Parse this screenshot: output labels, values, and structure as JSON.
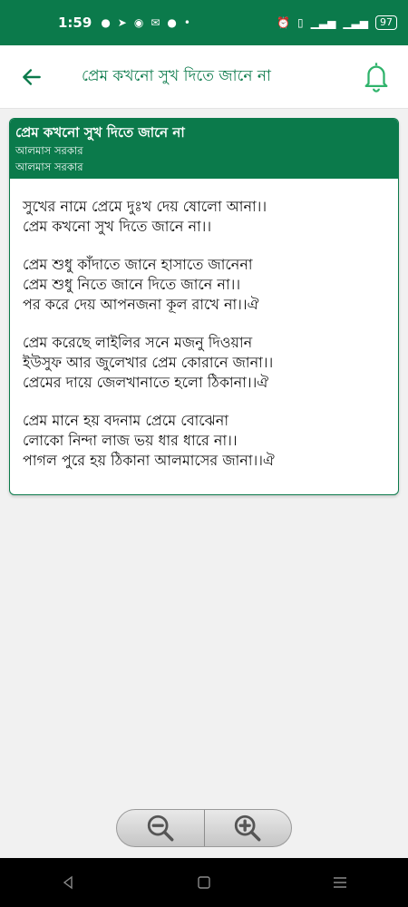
{
  "status_bar": {
    "time": "1:59",
    "battery": "97"
  },
  "header": {
    "title": "প্রেম কখনো সুখ দিতে জানে না"
  },
  "song": {
    "title": "প্রেম কখনো সুখ দিতে জানে না",
    "artist_line1": "আলমাস সরকার",
    "artist_line2": "আলমাস সরকার",
    "stanzas": [
      [
        "সুখের নামে প্রেমে দুঃখ দেয় ষোলো আনা।।",
        "প্রেম কখনো সুখ দিতে জানে না।।"
      ],
      [
        "প্রেম শুধু কাঁদাতে জানে হাসাতে জানেনা",
        "প্রেম শুধু নিতে জানে দিতে জানে না।।",
        "পর করে দেয় আপনজনা কূল রাখে না।।ঐ"
      ],
      [
        "প্রেম করেছে লাইলির সনে মজনু দিওয়ান",
        "ইউসুফ আর জুলেখার প্রেম কোরানে জানা।।",
        "প্রেমের দায়ে জেলখানাতে হলো ঠিকানা।।ঐ"
      ],
      [
        "প্রেম মানে হয় বদনাম প্রেমে বোঝেনা",
        "লোকো নিন্দা লাজ ভয় ধার ধারে না।।",
        "পাগল পুরে হয় ঠিকানা আলমাসের জানা।।ঐ"
      ]
    ]
  },
  "icons": {
    "back": "arrow-left-icon",
    "bell": "bell-icon",
    "zoom_out": "zoom-out-icon",
    "zoom_in": "zoom-in-icon",
    "nav_back": "triangle-back-icon",
    "nav_home": "square-home-icon",
    "nav_menu": "menu-lines-icon"
  },
  "colors": {
    "primary": "#0b7a4b",
    "background": "#f1f1f1"
  }
}
